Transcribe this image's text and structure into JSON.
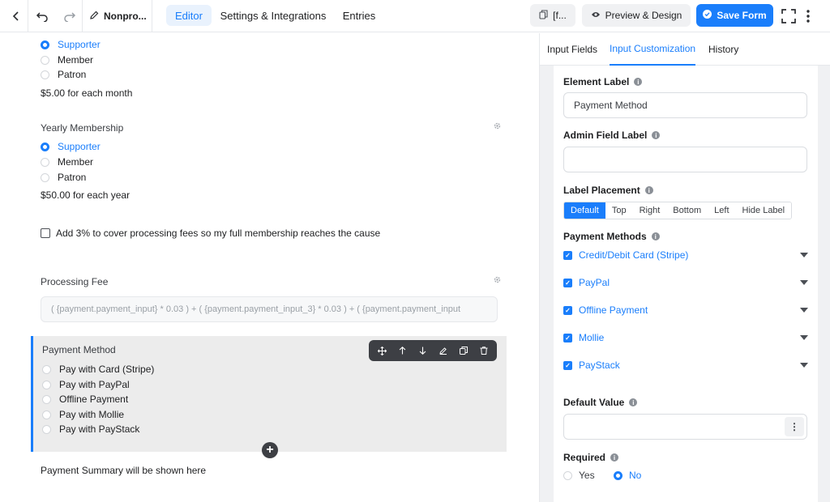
{
  "topbar": {
    "form_title": "Nonpro...",
    "tabs": [
      {
        "label": "Editor",
        "active": true
      },
      {
        "label": "Settings & Integrations",
        "active": false
      },
      {
        "label": "Entries",
        "active": false
      }
    ],
    "shortcode_label": "[f...",
    "preview_label": "Preview & Design",
    "save_label": "Save Form"
  },
  "canvas": {
    "monthly": {
      "options": [
        {
          "label": "Supporter",
          "selected": true
        },
        {
          "label": "Member",
          "selected": false
        },
        {
          "label": "Patron",
          "selected": false
        }
      ],
      "price_text": "$5.00 for each month"
    },
    "yearly": {
      "label": "Yearly Membership",
      "options": [
        {
          "label": "Supporter",
          "selected": true
        },
        {
          "label": "Member",
          "selected": false
        },
        {
          "label": "Patron",
          "selected": false
        }
      ],
      "price_text": "$50.00 for each year"
    },
    "fee_checkbox_label": "Add 3% to cover processing fees so my full membership reaches the cause",
    "processing_fee": {
      "label": "Processing Fee",
      "formula": "( {payment.payment_input} * 0.03 ) + ( {payment.payment_input_3} * 0.03 ) + ( {payment.payment_input"
    },
    "payment_method": {
      "label": "Payment Method",
      "options": [
        "Pay with Card (Stripe)",
        "Pay with PayPal",
        "Offline Payment",
        "Pay with Mollie",
        "Pay with PayStack"
      ]
    },
    "summary_text": "Payment Summary will be shown here"
  },
  "panel": {
    "tabs": [
      {
        "label": "Input Fields",
        "active": false
      },
      {
        "label": "Input Customization",
        "active": true
      },
      {
        "label": "History",
        "active": false
      }
    ],
    "element_label": {
      "label": "Element Label",
      "value": "Payment Method"
    },
    "admin_label": {
      "label": "Admin Field Label",
      "value": ""
    },
    "label_placement": {
      "label": "Label Placement",
      "options": [
        "Default",
        "Top",
        "Right",
        "Bottom",
        "Left",
        "Hide Label"
      ],
      "selected": "Default"
    },
    "payment_methods": {
      "label": "Payment Methods",
      "items": [
        {
          "label": "Credit/Debit Card (Stripe)",
          "checked": true
        },
        {
          "label": "PayPal",
          "checked": true
        },
        {
          "label": "Offline Payment",
          "checked": true
        },
        {
          "label": "Mollie",
          "checked": true
        },
        {
          "label": "PayStack",
          "checked": true
        }
      ]
    },
    "default_value": {
      "label": "Default Value",
      "value": ""
    },
    "required": {
      "label": "Required",
      "options": [
        "Yes",
        "No"
      ],
      "selected": "No"
    }
  },
  "colors": {
    "accent": "#1a7efb",
    "dark_toolbar": "#3d3f44"
  }
}
